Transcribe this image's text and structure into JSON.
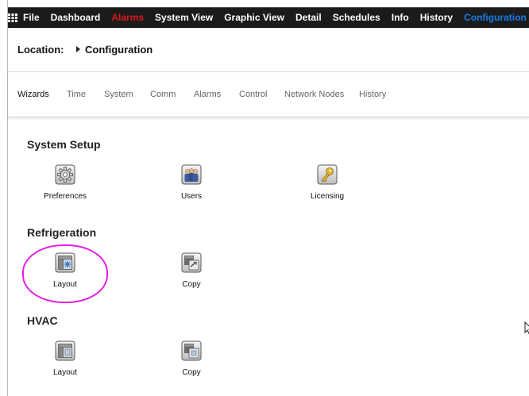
{
  "menu": {
    "items": [
      {
        "label": "File",
        "state": "normal"
      },
      {
        "label": "Dashboard",
        "state": "normal"
      },
      {
        "label": "Alarms",
        "state": "alarm"
      },
      {
        "label": "System View",
        "state": "normal"
      },
      {
        "label": "Graphic View",
        "state": "normal"
      },
      {
        "label": "Detail",
        "state": "normal"
      },
      {
        "label": "Schedules",
        "state": "normal"
      },
      {
        "label": "Info",
        "state": "normal"
      },
      {
        "label": "History",
        "state": "normal"
      },
      {
        "label": "Configuration",
        "state": "active"
      }
    ]
  },
  "location": {
    "label": "Location:",
    "value": "Configuration"
  },
  "tabs": [
    "Wizards",
    "Time",
    "System",
    "Comm",
    "Alarms",
    "Control",
    "Network Nodes",
    "History"
  ],
  "sections": [
    {
      "title": "System Setup",
      "items": [
        {
          "label": "Preferences",
          "icon": "gear-icon"
        },
        {
          "label": "Users",
          "icon": "users-icon"
        },
        {
          "label": "Licensing",
          "icon": "key-icon"
        }
      ]
    },
    {
      "title": "Refrigeration",
      "items": [
        {
          "label": "Layout",
          "icon": "layout-snowflake-icon"
        },
        {
          "label": "Copy",
          "icon": "copy-icon"
        }
      ]
    },
    {
      "title": "HVAC",
      "items": [
        {
          "label": "Layout",
          "icon": "layout-hvac-icon"
        },
        {
          "label": "Copy",
          "icon": "copy-icon"
        }
      ]
    }
  ],
  "colors": {
    "menu_bg": "#1b1b1b",
    "alarm": "#d81919",
    "active": "#1a7de6",
    "highlight": "#e61ee6"
  }
}
